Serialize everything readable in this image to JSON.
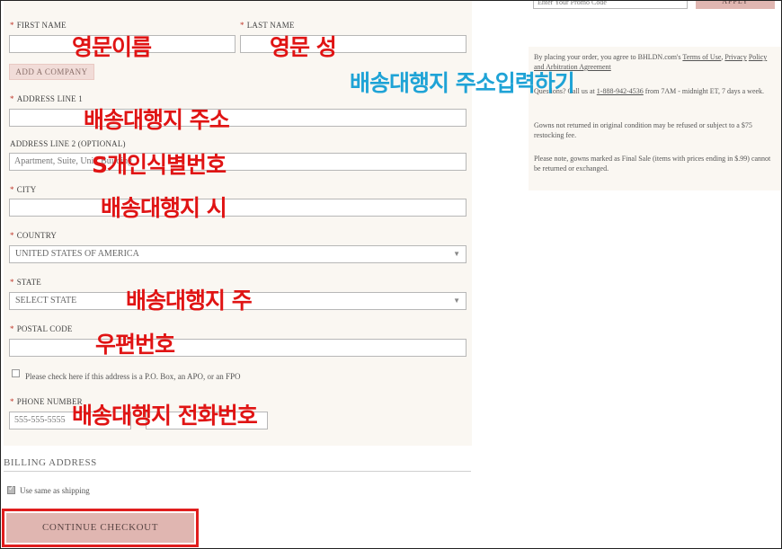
{
  "form": {
    "first_name": {
      "label": "First Name",
      "value": ""
    },
    "last_name": {
      "label": "Last Name",
      "value": ""
    },
    "add_company": "ADD A COMPANY",
    "address1": {
      "label": "Address Line 1",
      "value": ""
    },
    "address2": {
      "label": "Address Line 2 (Optional)",
      "placeholder": "Apartment, Suite, Unit, Building"
    },
    "city": {
      "label": "City",
      "value": ""
    },
    "country": {
      "label": "Country",
      "value": "UNITED STATES OF AMERICA"
    },
    "state": {
      "label": "State",
      "value": "SELECT STATE"
    },
    "postal": {
      "label": "Postal Code",
      "value": ""
    },
    "po_box_text": "Please check here if this address is a P.O. Box, an APO, or an FPO",
    "phone": {
      "label": "Phone Number",
      "placeholder": "555-555-5555"
    },
    "required_mark": "*"
  },
  "billing": {
    "title": "BILLING ADDRESS",
    "same_as_shipping": "Use same as shipping",
    "continue_label": "CONTINUE CHECKOUT"
  },
  "sidebar": {
    "promo_placeholder": "Enter Your Promo Code",
    "apply_label": "APPLY",
    "terms_prefix": "By placing your order, you agree to BHLDN.com's ",
    "terms_link": "Terms of Use",
    "terms_mid": ", ",
    "privacy_link": "Privacy",
    "policy_link": "Policy and Arbitration Agreement",
    "contact_prefix": "Questions? Call us at ",
    "contact_phone": "1-888-942-4536",
    "contact_suffix": " from 7AM - midnight ET, 7 days a week.",
    "gowns_returned": "Gowns not returned in original condition may be refused or subject to a $75 restocking fee.",
    "final_sale": "Please note, gowns marked as Final Sale (items with prices ending in $.99) cannot be returned or exchanged."
  },
  "annotations": {
    "first_name": "영문이름",
    "last_name": "영문 성",
    "header": "배송대행지 주소입력하기",
    "address1": "배송대행지 주소",
    "address2": "S개인식별번호",
    "city": "배송대행지 시",
    "state": "배송대행지 주",
    "postal": "우편번호",
    "phone": "배송대행지 전화번호"
  },
  "colors": {
    "annotation_red": "#e01414",
    "annotation_blue": "#1fa3d6",
    "button_pink": "#e0b6b1",
    "highlight_border": "#e01e1e"
  }
}
